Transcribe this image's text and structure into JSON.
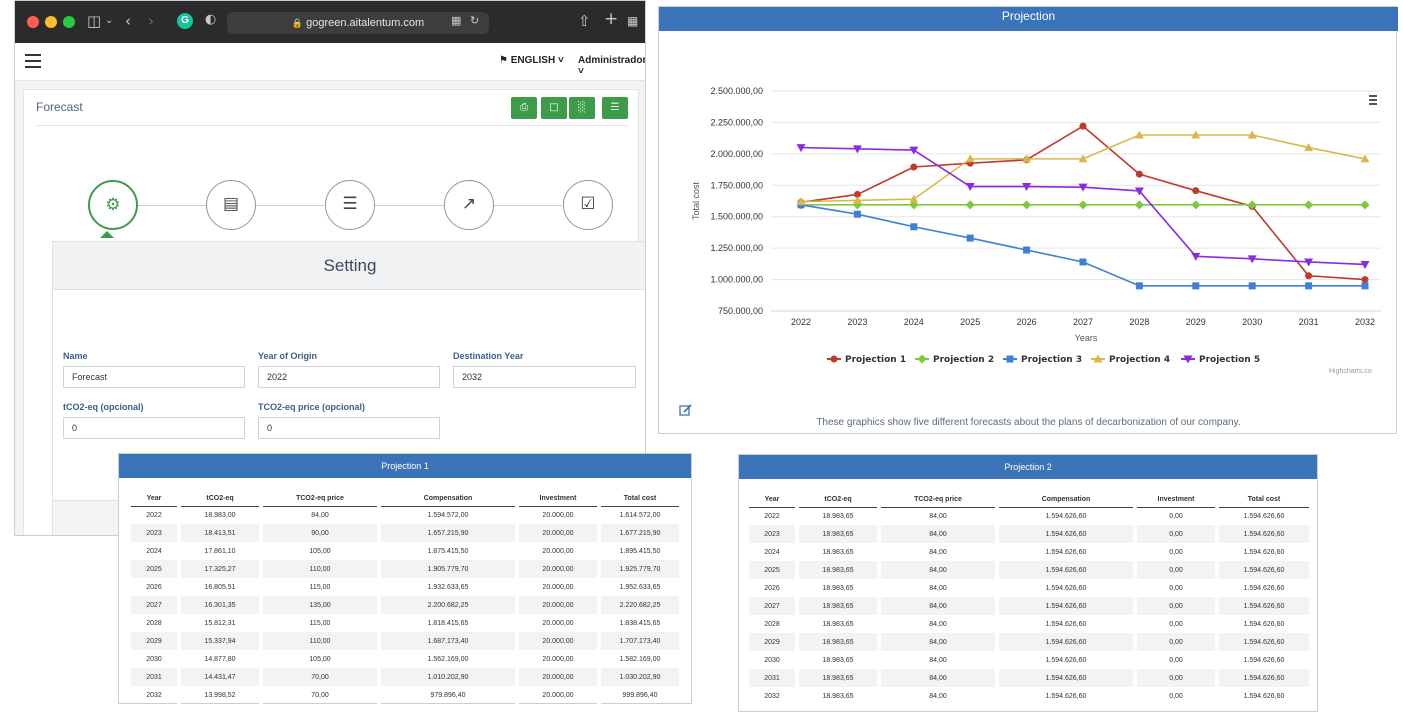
{
  "browser": {
    "url": "gogreen.aitalentum.com",
    "language": "ENGLISH",
    "user": "Administrador",
    "page_title": "Forecast",
    "toolbar": [
      "print-icon",
      "file-icon",
      "bar-chart-icon",
      "list-icon"
    ],
    "steps": [
      "gears-icon",
      "table-icon",
      "sliders-icon",
      "line-chart-icon",
      "check-square-icon"
    ],
    "setting": {
      "title": "Setting",
      "name_label": "Name",
      "name_value": "Forecast",
      "origin_label": "Year of Origin",
      "origin_value": "2022",
      "dest_label": "Destination Year",
      "dest_value": "2032",
      "tco2_label": "tCO2-eq (opcional)",
      "tco2_value": "0",
      "price_label": "TCO2-eq price (opcional)",
      "price_value": "0"
    }
  },
  "chart_window": {
    "header": "Projection",
    "caption": "These graphics show five different forecasts about the plans of decarbonization of our company.",
    "credit": "Highcharts.co"
  },
  "chart_data": {
    "type": "line",
    "xlabel": "Years",
    "ylabel": "Total cost",
    "ylim": [
      750000,
      2500000
    ],
    "yticks": [
      "750.000,00",
      "1.000.000,00",
      "1.250.000,00",
      "1.500.000,00",
      "1.750.000,00",
      "2.000.000,00",
      "2.250.000,00",
      "2.500.000,00"
    ],
    "ytick_values": [
      750000,
      1000000,
      1250000,
      1500000,
      1750000,
      2000000,
      2250000,
      2500000
    ],
    "x": [
      "2022",
      "2023",
      "2024",
      "2025",
      "2026",
      "2027",
      "2028",
      "2029",
      "2030",
      "2031",
      "2032"
    ],
    "grid": true,
    "legend": "bottom",
    "series": [
      {
        "name": "Projection 1",
        "color": "#c0392b",
        "marker": "circle",
        "values": [
          1614572,
          1677216,
          1895416,
          1925780,
          1952634,
          2220682,
          1838416,
          1707173,
          1582169,
          1030203,
          999896
        ]
      },
      {
        "name": "Projection 2",
        "color": "#7cc93a",
        "marker": "diamond",
        "values": [
          1594627,
          1594627,
          1594627,
          1594627,
          1594627,
          1594627,
          1594627,
          1594627,
          1594627,
          1594627,
          1594627
        ]
      },
      {
        "name": "Projection 3",
        "color": "#3f7fd6",
        "marker": "square",
        "values": [
          1594627,
          1520000,
          1420000,
          1330000,
          1235000,
          1140000,
          950000,
          950000,
          950000,
          950000,
          950000
        ]
      },
      {
        "name": "Projection 4",
        "color": "#d9b84a",
        "marker": "triangle",
        "values": [
          1620000,
          1630000,
          1640000,
          1960000,
          1960000,
          1960000,
          2150000,
          2150000,
          2150000,
          2050000,
          1960000
        ]
      },
      {
        "name": "Projection 5",
        "color": "#8a2be2",
        "marker": "triangle-down",
        "values": [
          2050000,
          2040000,
          2030000,
          1740000,
          1740000,
          1735000,
          1705000,
          1185000,
          1165000,
          1140000,
          1120000
        ]
      }
    ]
  },
  "table1": {
    "title": "Projection 1",
    "columns": [
      "Year",
      "tCO2-eq",
      "TCO2-eq price",
      "Compensation",
      "Investment",
      "Total cost"
    ],
    "rows": [
      [
        "2022",
        "18.983,00",
        "84,00",
        "1.594.572,00",
        "20.000,00",
        "1.614.572,00"
      ],
      [
        "2023",
        "18.413,51",
        "90,00",
        "1.657.215,90",
        "20.000,00",
        "1.677.215,90"
      ],
      [
        "2024",
        "17.861,10",
        "105,00",
        "1.875.415,50",
        "20.000,00",
        "1.895.415,50"
      ],
      [
        "2025",
        "17.325,27",
        "110,00",
        "1.905.779,70",
        "20.000,00",
        "1.925.779,70"
      ],
      [
        "2026",
        "16.805,51",
        "115,00",
        "1.932.633,65",
        "20.000,00",
        "1.952.633,65"
      ],
      [
        "2027",
        "16.301,35",
        "135,00",
        "2.200.682,25",
        "20.000,00",
        "2.220.682,25"
      ],
      [
        "2028",
        "15.812,31",
        "115,00",
        "1.818.415,65",
        "20.000,00",
        "1.838.415,65"
      ],
      [
        "2029",
        "15.337,94",
        "110,00",
        "1.687.173,40",
        "20.000,00",
        "1.707.173,40"
      ],
      [
        "2030",
        "14.877,80",
        "105,00",
        "1.562.169,00",
        "20.000,00",
        "1.582.169,00"
      ],
      [
        "2031",
        "14.431,47",
        "70,00",
        "1.010.202,90",
        "20.000,00",
        "1.030.202,90"
      ],
      [
        "2032",
        "13.998,52",
        "70,00",
        "979.896,40",
        "20.000,00",
        "999.896,40"
      ]
    ]
  },
  "table2": {
    "title": "Projection 2",
    "columns": [
      "Year",
      "tCO2-eq",
      "TCO2-eq price",
      "Compensation",
      "Investment",
      "Total cost"
    ],
    "rows": [
      [
        "2022",
        "18.983,65",
        "84,00",
        "1.594.626,60",
        "0,00",
        "1.594.626,60"
      ],
      [
        "2023",
        "18.983,65",
        "84,00",
        "1.594.626,60",
        "0,00",
        "1.594.626,60"
      ],
      [
        "2024",
        "18.983,65",
        "84,00",
        "1.594.626,60",
        "0,00",
        "1.594.626,60"
      ],
      [
        "2025",
        "18.983,65",
        "84,00",
        "1.594.626,60",
        "0,00",
        "1.594.626,60"
      ],
      [
        "2026",
        "18.983,65",
        "84,00",
        "1.594.626,60",
        "0,00",
        "1.594.626,60"
      ],
      [
        "2027",
        "18.983,65",
        "84,00",
        "1.594.626,60",
        "0,00",
        "1.594.626,60"
      ],
      [
        "2028",
        "18.983,65",
        "84,00",
        "1.594.626,60",
        "0,00",
        "1.594.626,60"
      ],
      [
        "2029",
        "18.983,65",
        "84,00",
        "1.594.626,60",
        "0,00",
        "1.594.626,60"
      ],
      [
        "2030",
        "18.983,65",
        "84,00",
        "1.594.626,60",
        "0,00",
        "1.594.626,60"
      ],
      [
        "2031",
        "18.983,65",
        "84,00",
        "1.594.626,60",
        "0,00",
        "1.594.626,60"
      ],
      [
        "2032",
        "18.983,65",
        "84,00",
        "1.594.626,60",
        "0,00",
        "1.594.626,60"
      ]
    ]
  }
}
